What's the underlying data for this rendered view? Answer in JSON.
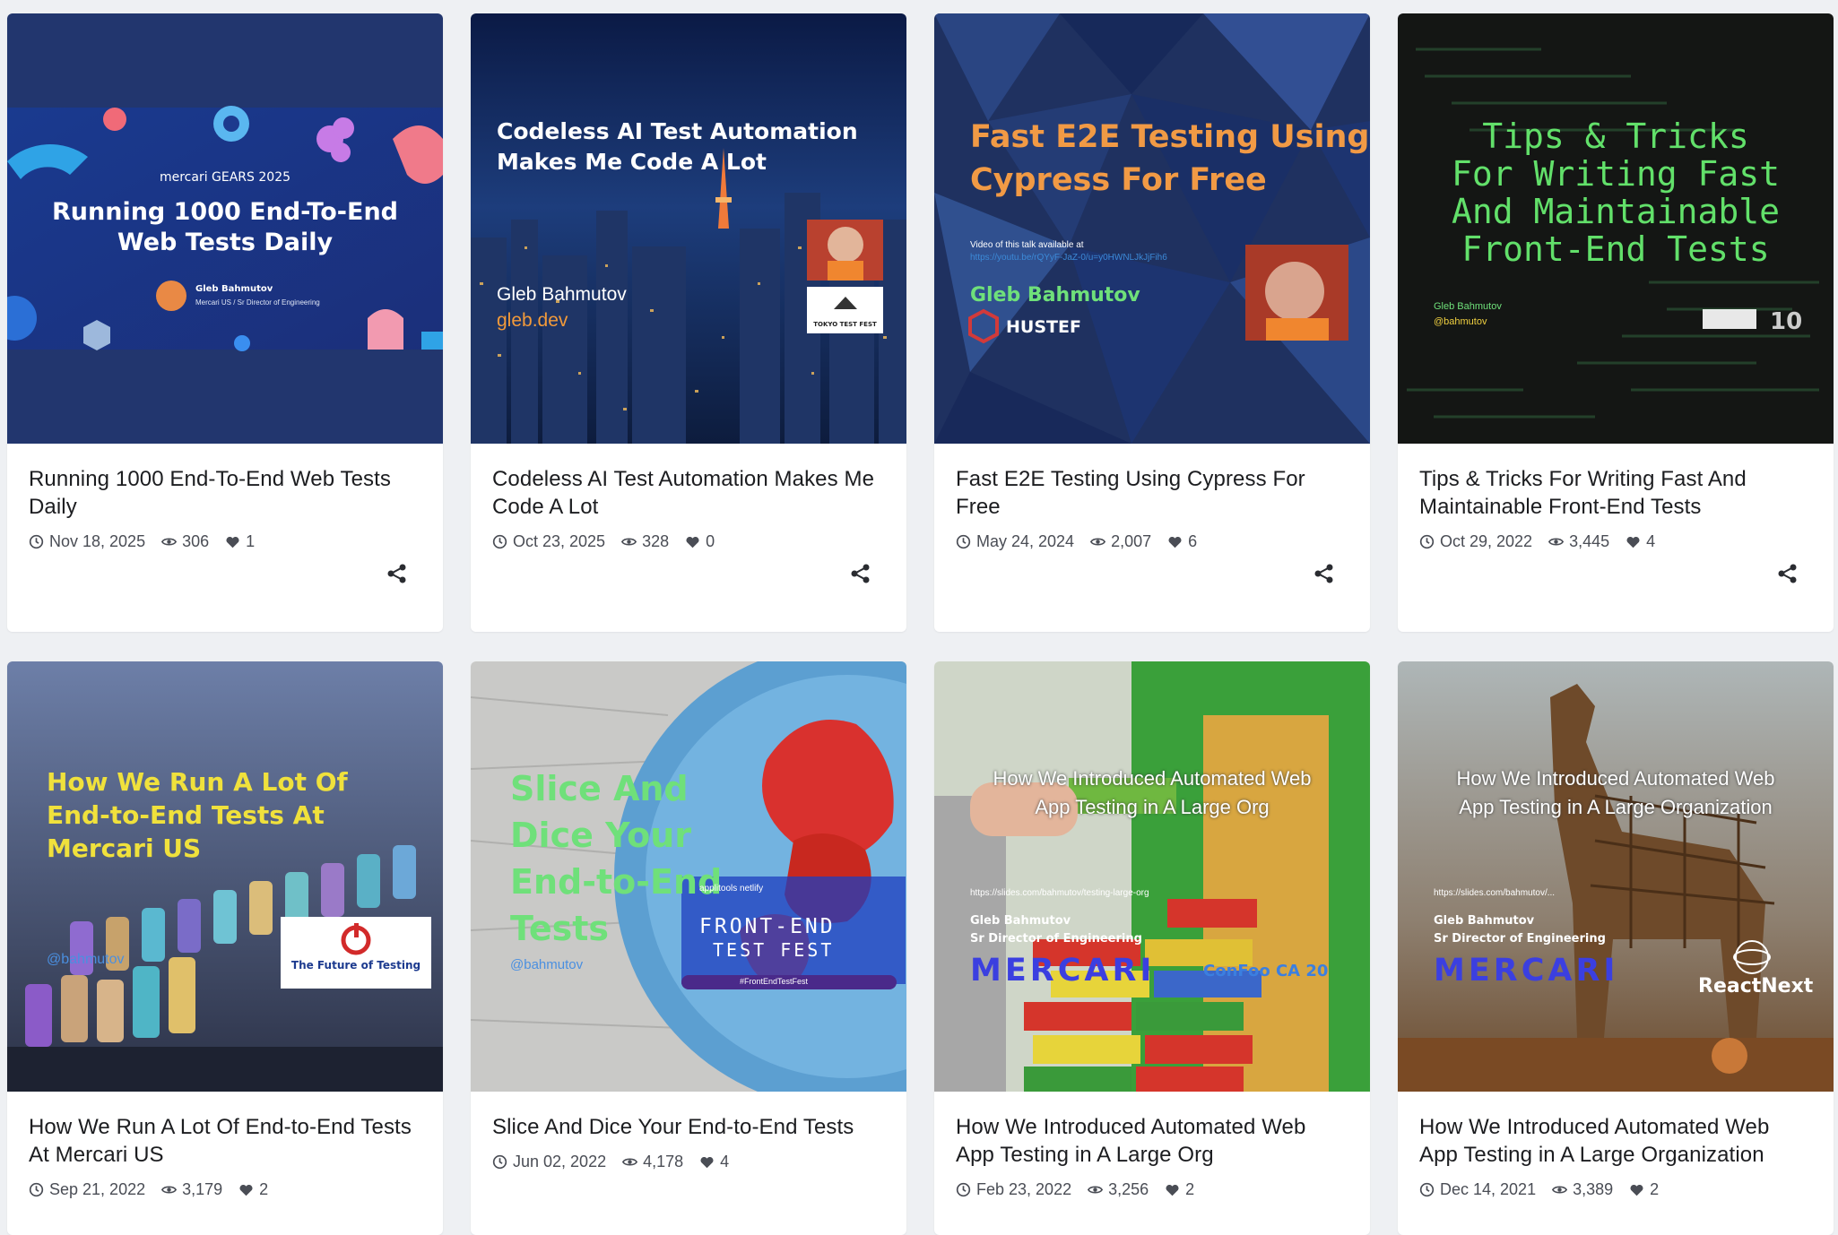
{
  "cards": [
    {
      "title": "Running 1000 End-To-End Web Tests Daily",
      "date": "Nov 18, 2025",
      "views": "306",
      "likes": "1",
      "thumb": {
        "brand": "mercari GEARS 2025",
        "heading1": "Running 1000 End-To-End",
        "heading2": "Web Tests Daily",
        "speaker": "Gleb Bahmutov",
        "role": "Mercari US / Sr Director of Engineering"
      }
    },
    {
      "title": "Codeless AI Test Automation Makes Me Code A Lot",
      "date": "Oct 23, 2025",
      "views": "328",
      "likes": "0",
      "thumb": {
        "heading1": "Codeless AI Test Automation",
        "heading2": "Makes Me Code A Lot",
        "speaker": "Gleb Bahmutov",
        "site": "gleb.dev",
        "badge": "TOKYO TEST FEST"
      }
    },
    {
      "title": "Fast E2E Testing Using Cypress For Free",
      "date": "May 24, 2024",
      "views": "2,007",
      "likes": "6",
      "thumb": {
        "heading1": "Fast E2E Testing Using",
        "heading2": "Cypress For Free",
        "note": "Video of this talk available at",
        "url": "https://youtu.be/rQYyF-JaZ-0/u=y0HWNLJkJjFih6",
        "speaker": "Gleb Bahmutov",
        "event": "HUSTEF"
      }
    },
    {
      "title": "Tips & Tricks For Writing Fast And Maintainable Front-End Tests",
      "date": "Oct 29, 2022",
      "views": "3,445",
      "likes": "4",
      "thumb": {
        "lines": [
          "Tips & Tricks",
          "For Writing Fast",
          "And Maintainable",
          "Front-End Tests"
        ],
        "speaker": "Gleb Bahmutov",
        "handle": "@bahmutov"
      }
    },
    {
      "title": "How We Run A Lot Of End-to-End Tests At Mercari US",
      "date": "Sep 21, 2022",
      "views": "3,179",
      "likes": "2",
      "thumb": {
        "lines": [
          "How We Run A Lot Of",
          "End-to-End Tests At",
          "Mercari US"
        ],
        "handle": "@bahmutov",
        "badge": "The Future of Testing"
      }
    },
    {
      "title": "Slice And Dice Your End-to-End Tests",
      "date": "Jun 02, 2022",
      "views": "4,178",
      "likes": "4",
      "thumb": {
        "lines": [
          "Slice And",
          "Dice Your",
          "End-to-End",
          "Tests"
        ],
        "handle": "@bahmutov",
        "fest1": "FRONT-END",
        "fest2": "TEST FEST",
        "sponsors": "applitools  netlify",
        "tag": "#FrontEndTestFest"
      }
    },
    {
      "title": "How We Introduced Automated Web App Testing in A Large Org",
      "date": "Feb 23, 2022",
      "views": "3,256",
      "likes": "2",
      "thumb": {
        "heading1": "How We Introduced Automated Web",
        "heading2": "App Testing in A Large Org",
        "url": "https://slides.com/bahmutov/testing-large-org",
        "speaker": "Gleb Bahmutov",
        "role": "Sr Director of Engineering",
        "brand": "MERCARI",
        "event": "ConFoo CA 20"
      }
    },
    {
      "title": "How We Introduced Automated Web App Testing in A Large Organization",
      "date": "Dec 14, 2021",
      "views": "3,389",
      "likes": "2",
      "thumb": {
        "heading1": "How We Introduced Automated Web",
        "heading2": "App Testing in A Large Organization",
        "url": "https://slides.com/bahmutov/...",
        "speaker": "Gleb Bahmutov",
        "role": "Sr Director of Engineering",
        "brand": "MERCARI",
        "event": "ReactNext"
      }
    }
  ],
  "colors": {
    "pageBg": "#eef0f3",
    "cardBg": "#ffffff",
    "title": "#1c1d20",
    "meta": "#4a4d55"
  },
  "icons": {
    "date": "clock-icon",
    "views": "eye-icon",
    "likes": "heart-icon",
    "share": "share-icon"
  }
}
